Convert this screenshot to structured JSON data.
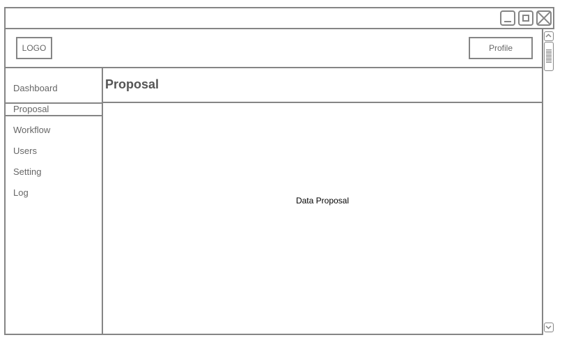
{
  "window": {
    "controls": {
      "minimize_icon": "minimize-icon",
      "maximize_icon": "maximize-icon",
      "close_icon": "close-icon"
    }
  },
  "header": {
    "logo": "LOGO",
    "profile_label": "Profile"
  },
  "sidebar": {
    "items": [
      {
        "label": "Dashboard",
        "active": false
      },
      {
        "label": "Proposal",
        "active": true
      },
      {
        "label": "Workflow",
        "active": false
      },
      {
        "label": "Users",
        "active": false
      },
      {
        "label": "Setting",
        "active": false
      },
      {
        "label": "Log",
        "active": false
      }
    ]
  },
  "main": {
    "title": "Proposal",
    "body_text": "Data Proposal"
  },
  "scrollbar": {
    "up_icon": "chevron-up-icon",
    "down_icon": "chevron-down-icon"
  },
  "colors": {
    "border": "#858585",
    "text": "#666666"
  }
}
